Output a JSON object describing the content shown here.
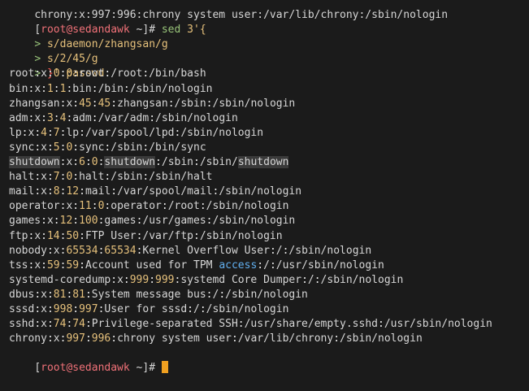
{
  "terminal": {
    "clipped_top_line": "chrony:x:997:996:chrony system user:/var/lib/chrony:/sbin/nologin",
    "prompt": {
      "open": "[",
      "user_host": "root@sedandawk",
      "path": " ~",
      "close": "]",
      "symbol": "#"
    },
    "command": {
      "name": " sed",
      "arg1": " 3'{",
      "cont_prefix": "> ",
      "line2": "s/daemon/zhangsan/g",
      "line3": "s/2/45/g",
      "line4_brace": "}",
      "line4_rest": "' passwd"
    },
    "output": [
      "root:x:0:0:root:/root:/bin/bash",
      "bin:x:1:1:bin:/bin:/sbin/nologin",
      "zhangsan:x:45:45:zhangsan:/sbin:/sbin/nologin",
      "adm:x:3:4:adm:/var/adm:/sbin/nologin",
      "lp:x:4:7:lp:/var/spool/lpd:/sbin/nologin",
      "sync:x:5:0:sync:/sbin:/bin/sync",
      "shutdown:x:6:0:shutdown:/sbin:/sbin/shutdown",
      "halt:x:7:0:halt:/sbin:/sbin/halt",
      "mail:x:8:12:mail:/var/spool/mail:/sbin/nologin",
      "operator:x:11:0:operator:/root:/sbin/nologin",
      "games:x:12:100:games:/usr/games:/sbin/nologin",
      "ftp:x:14:50:FTP User:/var/ftp:/sbin/nologin",
      "nobody:x:65534:65534:Kernel Overflow User:/:/sbin/nologin",
      "tss:x:59:59:Account used for TPM access:/:/usr/sbin/nologin",
      "systemd-coredump:x:999:999:systemd Core Dumper:/:/sbin/nologin",
      "dbus:x:81:81:System message bus:/:/sbin/nologin",
      "sssd:x:998:997:User for sssd:/:/sbin/nologin",
      "sshd:x:74:74:Privilege-separated SSH:/usr/share/empty.sshd:/usr/sbin/nologin",
      "chrony:x:997:996:chrony system user:/var/lib/chrony:/sbin/nologin"
    ],
    "highlighted_line_index": 6,
    "highlight_word": "shutdown",
    "colors": {
      "background": "#1b1b1b",
      "foreground": "#d6d6d6",
      "user_host": "#f07178",
      "command": "#98c379",
      "number": "#e5c07b",
      "keyword": "#61afef",
      "cursor": "#f0a020",
      "highlight": "#3a3a3a"
    }
  }
}
